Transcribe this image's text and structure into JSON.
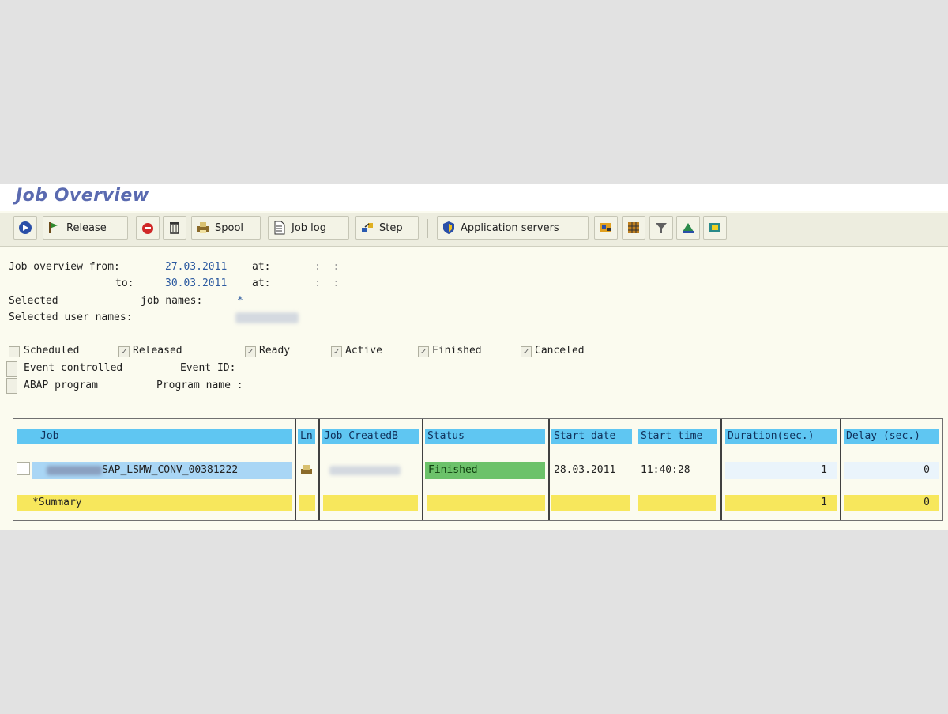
{
  "title": "Job Overview",
  "toolbar": {
    "release": "Release",
    "spool": "Spool",
    "job_log": "Job log",
    "step": "Step",
    "application_servers": "Application servers"
  },
  "criteria": {
    "from_label": "Job overview from:",
    "from_date": "27.03.2011",
    "at_label": "at:",
    "to_label": "to:",
    "to_date": "30.03.2011",
    "time_placeholder": ":  :",
    "selected_label": "Selected",
    "job_names_label": "job names:",
    "job_names_value": "*",
    "user_names_label": "Selected user names:"
  },
  "status_filters": [
    {
      "label": "Scheduled",
      "checked": false
    },
    {
      "label": "Released",
      "checked": true
    },
    {
      "label": "Ready",
      "checked": true
    },
    {
      "label": "Active",
      "checked": true
    },
    {
      "label": "Finished",
      "checked": true
    },
    {
      "label": "Canceled",
      "checked": true
    }
  ],
  "options": {
    "event_controlled": "Event controlled",
    "event_id_label": "Event ID:",
    "abap_program": "ABAP program",
    "program_name_label": "Program name :"
  },
  "table": {
    "headers": [
      "Job",
      "Ln",
      "Job CreatedB",
      "Status",
      "Start date",
      "Start time",
      "Duration(sec.)",
      "Delay (sec.)"
    ],
    "rows": [
      {
        "job": "SAP_LSMW_CONV_00381222",
        "status": "Finished",
        "start_date": "28.03.2011",
        "start_time": "11:40:28",
        "duration": "1",
        "delay": "0"
      }
    ],
    "summary": {
      "label": "*Summary",
      "duration": "1",
      "delay": "0"
    }
  },
  "colors": {
    "header_bg": "#5fc6f2",
    "finished_bg": "#6cc26a",
    "summary_bg": "#f7e75c",
    "title": "#5a6ab0"
  },
  "icons": [
    "execute-icon",
    "release-icon",
    "delete-icon",
    "trash-icon",
    "spool-icon",
    "job-log-icon",
    "step-icon",
    "server-icon",
    "settings-icon",
    "grid-icon",
    "filter-icon",
    "print-icon",
    "export-icon"
  ]
}
